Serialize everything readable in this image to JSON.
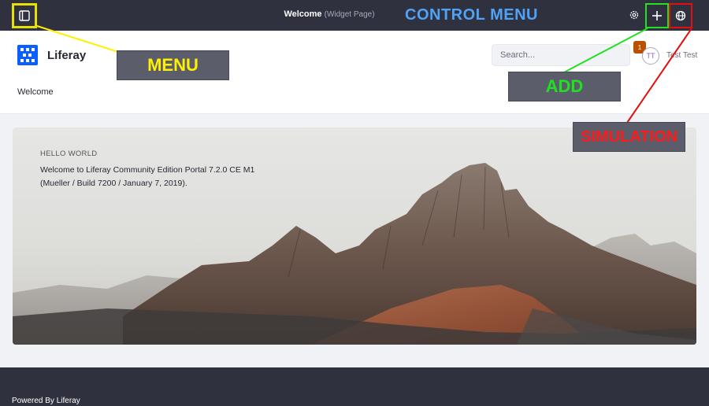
{
  "control_menu": {
    "page_title": "Welcome",
    "page_type": "(Widget Page)",
    "label": "CONTROL MENU",
    "icons": [
      "product-menu-icon",
      "gear-icon",
      "plus-icon",
      "simulation-icon"
    ]
  },
  "header": {
    "site_name": "Liferay",
    "nav_item": "Welcome",
    "search_placeholder": "Search...",
    "notification_count": "1",
    "avatar_initials": "TT",
    "user_name": "Test Test"
  },
  "hero": {
    "kicker": "HELLO WORLD",
    "line1": "Welcome to Liferay Community Edition Portal 7.2.0 CE M1",
    "line2": "(Mueller / Build 7200 / January 7, 2019)."
  },
  "footer": {
    "text": "Powered By Liferay"
  },
  "annotations": {
    "menu": "MENU",
    "add": "ADD",
    "simulation": "SIMULATION"
  },
  "colors": {
    "control_bar": "#30313f",
    "menu_annotation": "#ffef00",
    "add_annotation": "#20e020",
    "simulation_annotation": "#ff1a1a",
    "control_menu_label": "#4fa3f7",
    "brand": "#0b5fff"
  }
}
